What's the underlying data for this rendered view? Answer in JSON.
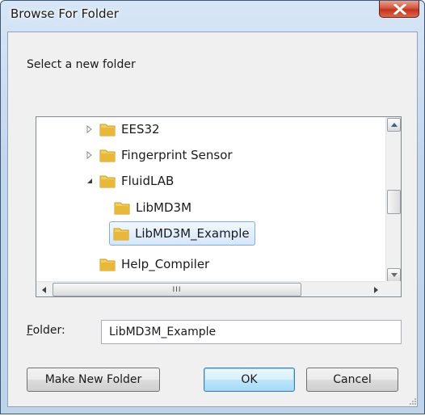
{
  "window": {
    "title": "Browse For Folder",
    "close_label": "X"
  },
  "description": "Select a new folder",
  "tree": {
    "items": [
      {
        "label": "EES32",
        "expander": "collapsed",
        "selected": false
      },
      {
        "label": "Fingerprint Sensor",
        "expander": "collapsed",
        "selected": false
      },
      {
        "label": "FluidLAB",
        "expander": "expanded",
        "selected": false
      },
      {
        "label": "LibMD3M",
        "expander": "none",
        "selected": false
      },
      {
        "label": "LibMD3M_Example",
        "expander": "none",
        "selected": true
      },
      {
        "label": "Help_Compiler",
        "expander": "none",
        "selected": false
      }
    ],
    "hscroll_thumb_label": "III"
  },
  "folder_field": {
    "label": "Folder:",
    "value": "LibMD3M_Example"
  },
  "buttons": {
    "make_new_folder": "Make New Folder",
    "ok": "OK",
    "cancel": "Cancel"
  },
  "colors": {
    "title_bar": "#c2d6ec",
    "close_button": "#c4331e",
    "folder": "#e8b83a",
    "selection_border": "#84acdd"
  }
}
